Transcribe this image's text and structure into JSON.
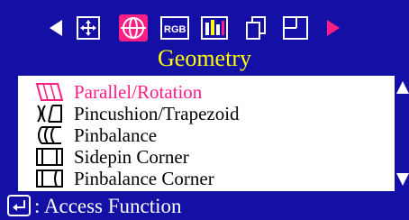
{
  "menu": {
    "tabs": [
      {
        "icon": "left-arrow-icon"
      },
      {
        "icon": "position-icon"
      },
      {
        "icon": "geometry-icon",
        "selected": true
      },
      {
        "icon": "rgb-icon",
        "text": "RGB"
      },
      {
        "icon": "color-bars-icon"
      },
      {
        "icon": "overlapping-windows-icon"
      },
      {
        "icon": "window-layout-icon"
      },
      {
        "icon": "right-arrow-icon"
      }
    ],
    "title": "Geometry"
  },
  "items": [
    {
      "label": "Parallel/Rotation",
      "icon": "parallel-rotation-icon",
      "selected": true
    },
    {
      "label": "Pincushion/Trapezoid",
      "icon": "pincushion-trapezoid-icon"
    },
    {
      "label": "Pinbalance",
      "icon": "pinbalance-icon"
    },
    {
      "label": "Sidepin Corner",
      "icon": "sidepin-corner-icon"
    },
    {
      "label": "Pinbalance Corner",
      "icon": "pinbalance-corner-icon"
    }
  ],
  "footer": {
    "icon": "enter-key-icon",
    "text": ": Access Function"
  },
  "colors": {
    "background": "#1410a6",
    "title": "#ffff00",
    "selected_text": "#ff1e83",
    "selected_tab": "#ff1e83",
    "arrow_right": "#ff1e83",
    "panel": "#ffffff"
  }
}
